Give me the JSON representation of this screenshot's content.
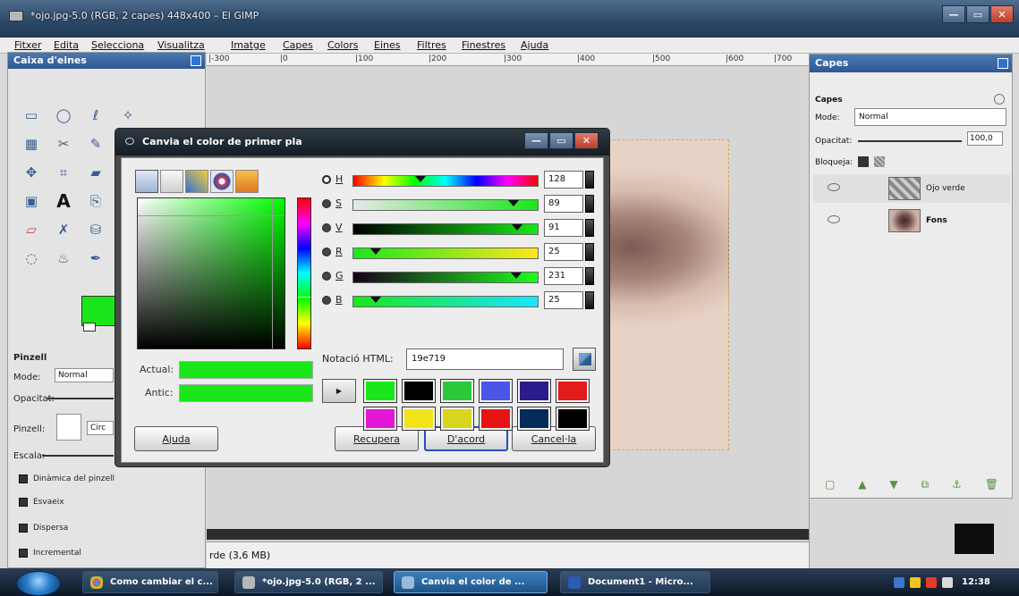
{
  "window": {
    "title": "*ojo.jpg-5.0 (RGB, 2 capes) 448x400 – El GIMP",
    "controls": [
      "—",
      "▭",
      "✕"
    ]
  },
  "menu": [
    "Fitxer",
    "Edita",
    "Selecciona",
    "Visualitza",
    "Imatge",
    "Capes",
    "Colors",
    "Eines",
    "Filtres",
    "Finestres",
    "Ajuda"
  ],
  "toolbox": {
    "title": "Caixa d'eines",
    "options_title": "Pinzell",
    "mode_label": "Mode:",
    "mode_value": "Normal",
    "opacity_label": "Opacitat:",
    "brush_label": "Pinzell:",
    "brush_value": "Circ",
    "scale_label": "Escala:",
    "checks": [
      "Dinàmica del pinzell",
      "Esvaeix",
      "Dispersa",
      "Incremental"
    ]
  },
  "ruler": [
    "|-300",
    "|0",
    "|100",
    "|200",
    "|300",
    "|400",
    "|500",
    "|600",
    "|700"
  ],
  "status": "rde (3,6 MB)",
  "layers": {
    "title": "Capes",
    "section": "Capes",
    "mode_label": "Mode:",
    "mode_value": "Normal",
    "opacity_label": "Opacitat:",
    "opacity_value": "100,0",
    "lock_label": "Bloqueja:",
    "rows": [
      {
        "name": "Ojo verde"
      },
      {
        "name": "Fons"
      }
    ]
  },
  "dialog": {
    "title": "Canvia el color de primer pla",
    "channels": [
      {
        "label": "H",
        "value": "128",
        "marker_fraction": 0.356
      },
      {
        "label": "S",
        "value": "89",
        "marker_fraction": 0.89
      },
      {
        "label": "V",
        "value": "91",
        "marker_fraction": 0.91
      },
      {
        "label": "R",
        "value": "25",
        "marker_fraction": 0.098
      },
      {
        "label": "G",
        "value": "231",
        "marker_fraction": 0.906
      },
      {
        "label": "B",
        "value": "25",
        "marker_fraction": 0.098
      }
    ],
    "html_label": "Notació HTML:",
    "html_value": "19e719",
    "current_label": "Actual:",
    "old_label": "Antic:",
    "current_color": "#19e719",
    "history_colors": [
      "#19e719",
      "#000000",
      "#2bc83a",
      "#4b55e8",
      "#2b1c8c",
      "#e21b1b",
      "#e316d7",
      "#f2e319",
      "#d8d61c",
      "#e81414",
      "#052b58",
      "#000000"
    ],
    "buttons": {
      "help": "Ajuda",
      "reset": "Recupera",
      "ok": "D'acord",
      "cancel": "Cancel·la"
    }
  },
  "taskbar": {
    "items": [
      "Como cambiar el c...",
      "*ojo.jpg-5.0 (RGB, 2 ...",
      "Canvia el color de ...",
      "Document1 - Micro..."
    ],
    "clock": "12:38"
  }
}
